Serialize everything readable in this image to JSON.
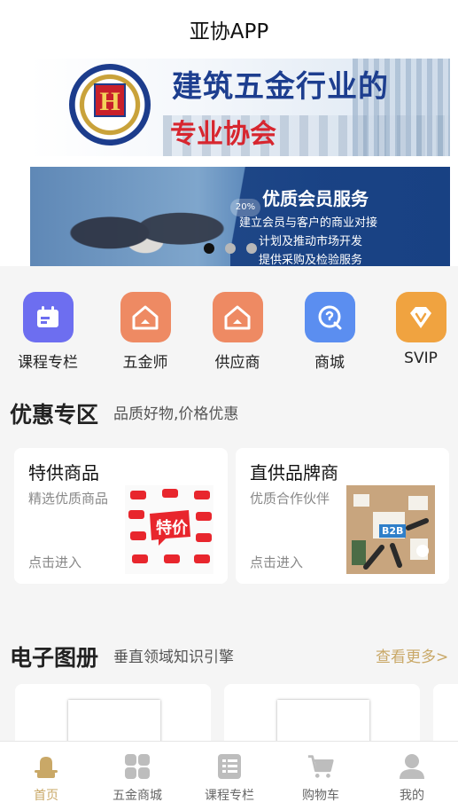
{
  "header": {
    "title": "亚协APP"
  },
  "banners": [
    {
      "title": "建筑五金行业的",
      "subtitle": "专业协会",
      "logo_text": "H"
    },
    {
      "title": "优质会员服务",
      "badge": "20%",
      "lines": [
        "建立会员与客户的商业对接",
        "计划及推动市场开发",
        "提供采购及检验服务"
      ]
    }
  ],
  "carousel": {
    "count": 3,
    "active": 0
  },
  "menu": [
    {
      "label": "课程专栏",
      "icon": "calendar-icon",
      "color": "#6d6ef0"
    },
    {
      "label": "五金师",
      "icon": "house-icon",
      "color": "#ee8a63"
    },
    {
      "label": "供应商",
      "icon": "house-icon",
      "color": "#ee8a63"
    },
    {
      "label": "商城",
      "icon": "search-icon",
      "color": "#5b8ef0"
    },
    {
      "label": "SVIP",
      "icon": "diamond-icon",
      "color": "#f0a340"
    }
  ],
  "promo": {
    "title": "优惠专区",
    "subtitle": "品质好物,价格优惠",
    "cards": [
      {
        "title": "特供商品",
        "subtitle": "精选优质商品",
        "enter": "点击进入",
        "image_text": "特价"
      },
      {
        "title": "直供品牌商",
        "subtitle": "优质合作伙伴",
        "enter": "点击进入",
        "image_text": "B2B"
      }
    ]
  },
  "albums": {
    "title": "电子图册",
    "subtitle": "垂直领域知识引擎",
    "more": "查看更多>"
  },
  "tabbar": [
    {
      "label": "首页",
      "icon": "home-icon",
      "active": true
    },
    {
      "label": "五金商城",
      "icon": "grid-icon",
      "active": false
    },
    {
      "label": "课程专栏",
      "icon": "list-icon",
      "active": false
    },
    {
      "label": "购物车",
      "icon": "cart-icon",
      "active": false
    },
    {
      "label": "我的",
      "icon": "user-icon",
      "active": false
    }
  ],
  "colors": {
    "accent": "#c9a867",
    "inactive": "#bdbdbd"
  }
}
